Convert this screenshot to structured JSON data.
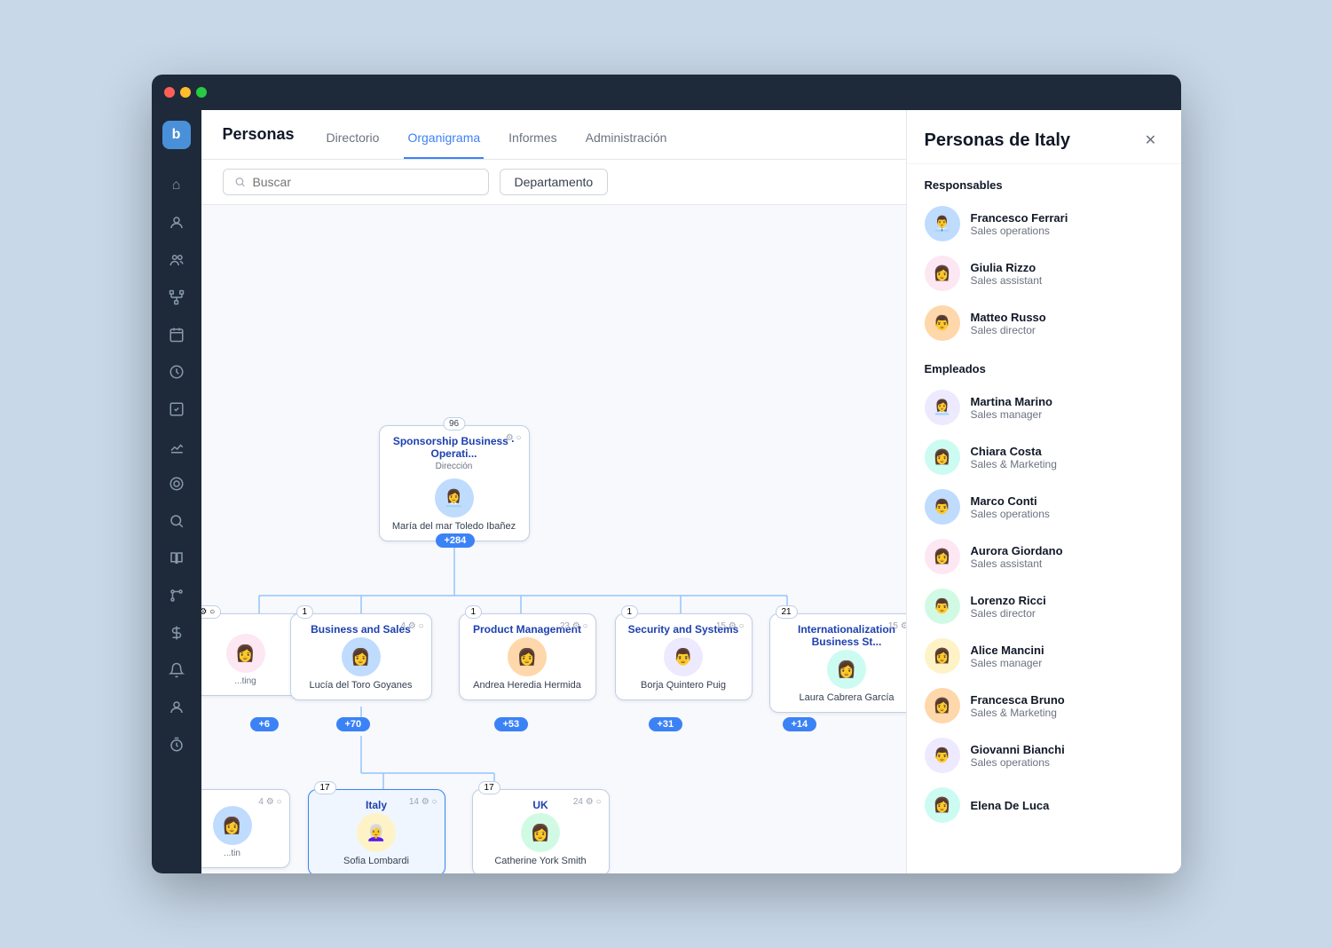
{
  "window": {
    "title": "Personas - Organigrama"
  },
  "topbar": {
    "page_title": "Personas",
    "tabs": [
      {
        "id": "directorio",
        "label": "Directorio",
        "active": false
      },
      {
        "id": "organigrama",
        "label": "Organigrama",
        "active": true
      },
      {
        "id": "informes",
        "label": "Informes",
        "active": false
      },
      {
        "id": "administracion",
        "label": "Administración",
        "active": false
      }
    ]
  },
  "toolbar": {
    "search_placeholder": "Buscar",
    "dept_button": "Departamento"
  },
  "org_nodes": {
    "root": {
      "title": "Sponsorship Business · Operati...",
      "subtitle": "Dirección",
      "name": "María del mar Toledo Ibañez",
      "count": 96,
      "expand": "+284"
    },
    "business": {
      "title": "Business and Sales",
      "count_badge": 1,
      "count_employees": 4,
      "name": "Lucía del Toro Goyanes",
      "expand": "+70"
    },
    "product": {
      "title": "Product Management",
      "count_badge": 1,
      "count_employees": 23,
      "name": "Andrea Heredia Hermida",
      "expand": "+53"
    },
    "security": {
      "title": "Security and Systems",
      "count_badge": 1,
      "count_employees": 15,
      "name": "Borja Quintero Puig",
      "expand": "+31"
    },
    "intl": {
      "title": "Internationalization Business St...",
      "count_badge": 21,
      "count_employees": 15,
      "name": "Laura Cabrera García",
      "expand": "+14"
    },
    "italy": {
      "title": "Italy",
      "count_badge": 17,
      "count_employees": 14,
      "name": "Sofia Lombardi"
    },
    "uk": {
      "title": "UK",
      "count_badge": 17,
      "count_employees": 24,
      "name": "Catherine York Smith"
    }
  },
  "panel": {
    "title": "Personas de Italy",
    "responsables_section": "Responsables",
    "empleados_section": "Empleados",
    "responsables": [
      {
        "name": "Francesco Ferrari",
        "role": "Sales operations",
        "emoji": "👨‍💼"
      },
      {
        "name": "Giulia Rizzo",
        "role": "Sales assistant",
        "emoji": "👩"
      },
      {
        "name": "Matteo Russo",
        "role": "Sales director",
        "emoji": "👨"
      }
    ],
    "empleados": [
      {
        "name": "Martina Marino",
        "role": "Sales manager",
        "emoji": "👩‍💼"
      },
      {
        "name": "Chiara Costa",
        "role": "Sales & Marketing",
        "emoji": "👩"
      },
      {
        "name": "Marco Conti",
        "role": "Sales operations",
        "emoji": "👨"
      },
      {
        "name": "Aurora Giordano",
        "role": "Sales assistant",
        "emoji": "👩"
      },
      {
        "name": "Lorenzo Ricci",
        "role": "Sales director",
        "emoji": "👨"
      },
      {
        "name": "Alice Mancini",
        "role": "Sales manager",
        "emoji": "👩"
      },
      {
        "name": "Francesca Bruno",
        "role": "Sales & Marketing",
        "emoji": "👩"
      },
      {
        "name": "Giovanni Bianchi",
        "role": "Sales operations",
        "emoji": "👨"
      },
      {
        "name": "Elena De Luca",
        "role": "",
        "emoji": "👩"
      }
    ]
  },
  "sidebar_icons": [
    {
      "name": "home-icon",
      "symbol": "⌂"
    },
    {
      "name": "person-icon",
      "symbol": "👤"
    },
    {
      "name": "people-icon",
      "symbol": "👥"
    },
    {
      "name": "network-icon",
      "symbol": "🔗"
    },
    {
      "name": "calendar-icon",
      "symbol": "📅"
    },
    {
      "name": "clock-icon",
      "symbol": "🕐"
    },
    {
      "name": "check-icon",
      "symbol": "✓"
    },
    {
      "name": "chart-icon",
      "symbol": "📊"
    },
    {
      "name": "target-icon",
      "symbol": "🎯"
    },
    {
      "name": "search2-icon",
      "symbol": "🔍"
    },
    {
      "name": "book-icon",
      "symbol": "📚"
    },
    {
      "name": "branch-icon",
      "symbol": "⑂"
    },
    {
      "name": "dollar-icon",
      "symbol": "💲"
    },
    {
      "name": "bell-icon",
      "symbol": "🔔"
    },
    {
      "name": "person2-icon",
      "symbol": "👤"
    },
    {
      "name": "time-icon",
      "symbol": "⏱"
    }
  ]
}
